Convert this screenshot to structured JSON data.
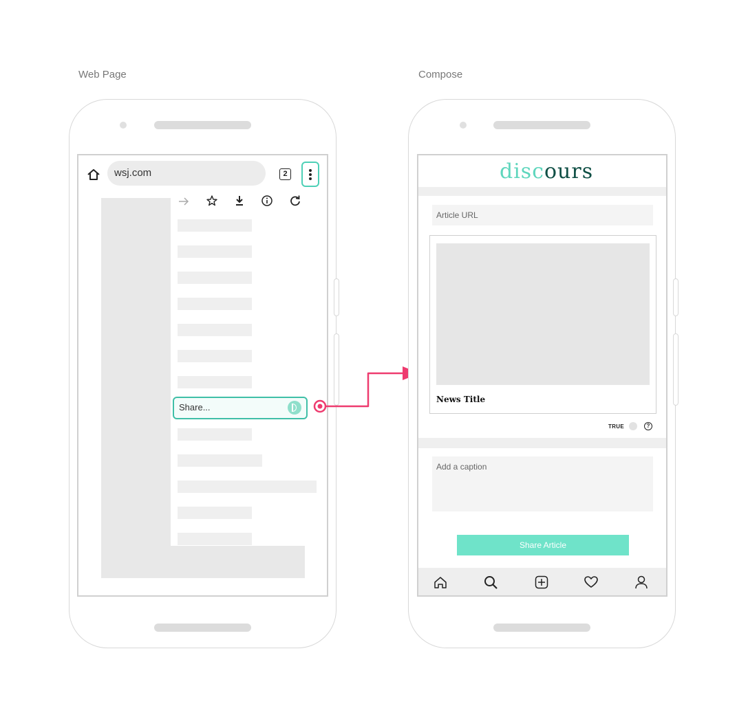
{
  "labels": {
    "left": "Web Page",
    "right": "Compose"
  },
  "browser": {
    "url": "wsj.com",
    "tab_count": "2",
    "share_label": "Share..."
  },
  "compose": {
    "logo_part1": "disc",
    "logo_part2": "ours",
    "article_url_placeholder": "Article URL",
    "news_title": "News Title",
    "true_label": "TRUE",
    "help_symbol": "?",
    "caption_placeholder": "Add a caption",
    "share_button": "Share Article"
  },
  "colors": {
    "accent": "#6fe3c9",
    "logo_light": "#5fd6bd",
    "logo_dark": "#0f4f45",
    "highlight_border": "#3fbfa7",
    "arrow": "#ee3b6f"
  },
  "icons": {
    "browser_toolbar": [
      "home-icon",
      "tab-switcher-icon",
      "more-vertical-icon"
    ],
    "menu_actions": [
      "forward-arrow-icon",
      "star-icon",
      "download-icon",
      "info-icon",
      "refresh-icon"
    ],
    "bottom_nav": [
      "home-icon",
      "search-icon",
      "add-square-icon",
      "heart-icon",
      "profile-icon"
    ]
  }
}
